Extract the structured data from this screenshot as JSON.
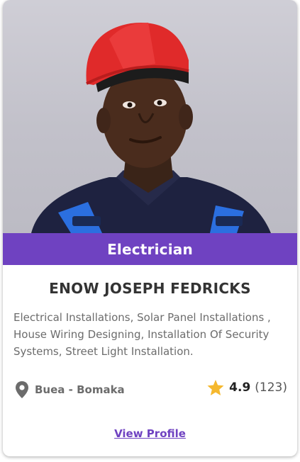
{
  "card": {
    "photo_alt": "portrait-photo",
    "category": "Electrician",
    "name": "ENOW JOSEPH FEDRICKS",
    "services": "Electrical Installations, Solar Panel Installations , House Wiring Designing, Installation Of Security Systems, Street Light Installation.",
    "location": {
      "icon": "map-pin-icon",
      "label": "Buea - Bomaka"
    },
    "rating": {
      "icon": "star-icon",
      "value": "4.9",
      "count": "(123)"
    },
    "view_profile_label": "View Profile"
  },
  "colors": {
    "accent": "#6f42c1",
    "star": "#f5b82e",
    "text_dark": "#333333",
    "text_muted": "#6c6c6c"
  }
}
